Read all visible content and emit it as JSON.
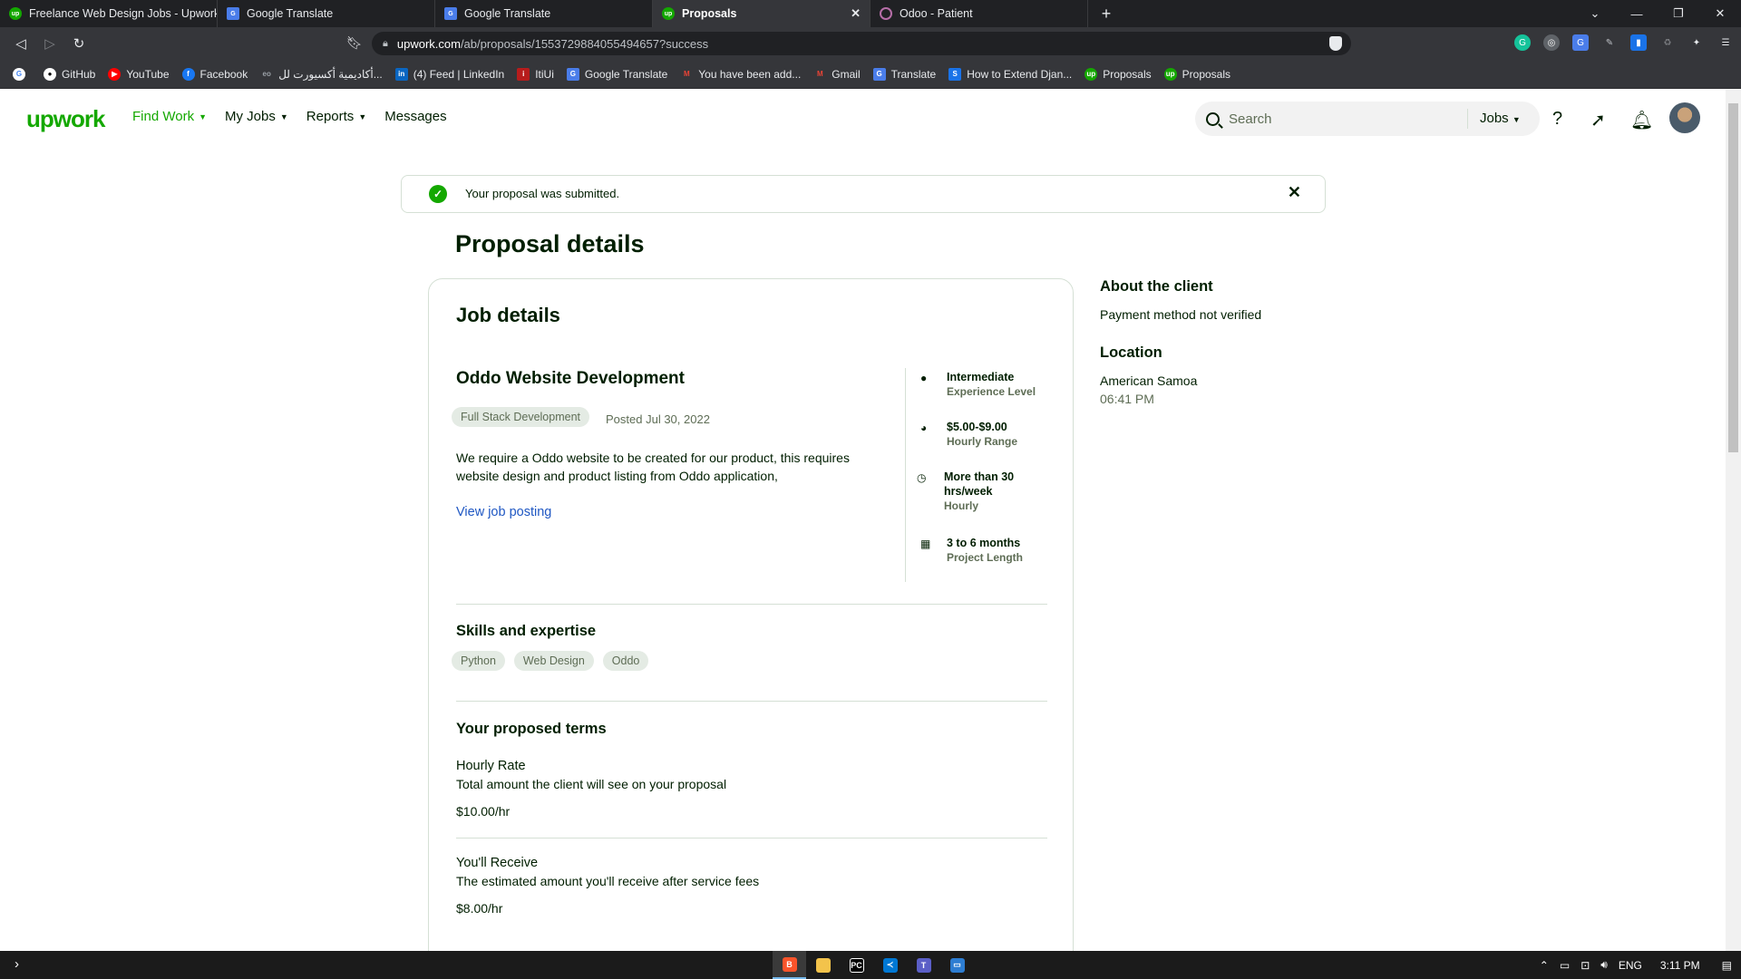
{
  "browser": {
    "tabs": [
      {
        "title": "Freelance Web Design Jobs - Upwork",
        "icon": "upwork-icon",
        "active": false
      },
      {
        "title": "Google Translate",
        "icon": "google-translate-icon",
        "active": false
      },
      {
        "title": "Google Translate",
        "icon": "google-translate-icon",
        "active": false
      },
      {
        "title": "Proposals",
        "icon": "upwork-icon",
        "active": true
      },
      {
        "title": "Odoo - Patient",
        "icon": "odoo-icon",
        "active": false
      }
    ],
    "url_host": "upwork.com",
    "url_path": "/ab/proposals/1553729884055494657?success",
    "bookmarks": [
      {
        "label": "",
        "icon": "google-icon"
      },
      {
        "label": "GitHub",
        "icon": "github-icon"
      },
      {
        "label": "YouTube",
        "icon": "youtube-icon"
      },
      {
        "label": "Facebook",
        "icon": "facebook-icon"
      },
      {
        "label": "أكاديمية أكسيورت لل...",
        "icon": "academy-icon"
      },
      {
        "label": "(4) Feed | LinkedIn",
        "icon": "linkedin-icon"
      },
      {
        "label": "ItiUi",
        "icon": "iti-icon"
      },
      {
        "label": "Google Translate",
        "icon": "google-translate-icon"
      },
      {
        "label": "You have been add...",
        "icon": "gmail-icon"
      },
      {
        "label": "Gmail",
        "icon": "gmail-icon"
      },
      {
        "label": "Translate",
        "icon": "google-translate-icon"
      },
      {
        "label": "How to Extend Djan...",
        "icon": "s-icon"
      },
      {
        "label": "Proposals",
        "icon": "upwork-icon"
      },
      {
        "label": "Proposals",
        "icon": "upwork-icon"
      }
    ]
  },
  "header": {
    "logo": "upwork",
    "nav": [
      {
        "label": "Find Work",
        "active": true,
        "dropdown": true
      },
      {
        "label": "My Jobs",
        "active": false,
        "dropdown": true
      },
      {
        "label": "Reports",
        "active": false,
        "dropdown": true
      },
      {
        "label": "Messages",
        "active": false,
        "dropdown": false
      }
    ],
    "search_placeholder": "Search",
    "search_scope": "Jobs"
  },
  "alert": {
    "message": "Your proposal was submitted."
  },
  "page": {
    "title": "Proposal details"
  },
  "job": {
    "section_title": "Job details",
    "title": "Oddo Website Development",
    "category": "Full Stack Development",
    "posted": "Posted Jul 30, 2022",
    "description": "We require a Oddo website to be created for our product, this requires website design and product listing from Oddo application,",
    "view_link": "View job posting",
    "features": [
      {
        "value": "Intermediate",
        "label": "Experience Level",
        "icon": "experience-icon"
      },
      {
        "value": "$5.00-$9.00",
        "label": "Hourly Range",
        "icon": "clock-icon"
      },
      {
        "value": "More than 30 hrs/week",
        "label": "Hourly",
        "icon": "time-icon"
      },
      {
        "value": "3 to 6 months",
        "label": "Project Length",
        "icon": "calendar-icon"
      }
    ]
  },
  "skills": {
    "title": "Skills and expertise",
    "items": [
      "Python",
      "Web Design",
      "Oddo"
    ]
  },
  "terms": {
    "title": "Your proposed terms",
    "hourly_rate_label": "Hourly Rate",
    "hourly_rate_sub": "Total amount the client will see on your proposal",
    "hourly_rate_value": "$10.00/hr",
    "receive_label": "You'll Receive",
    "receive_sub": "The estimated amount you'll receive after service fees",
    "receive_value": "$8.00/hr"
  },
  "client": {
    "title": "About the client",
    "payment": "Payment method not verified",
    "location_title": "Location",
    "country": "American Samoa",
    "time": "06:41 PM"
  },
  "taskbar": {
    "lang": "ENG",
    "time": "3:11 PM"
  },
  "colors": {
    "brand": "#14a800",
    "link": "#1f57c3",
    "text": "#001e00",
    "muted": "#5e6d55"
  }
}
